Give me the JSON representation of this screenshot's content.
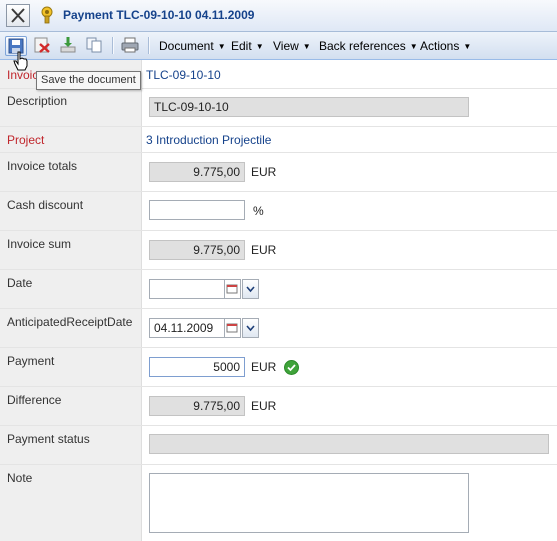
{
  "window": {
    "title": "Payment TLC-09-10-10 04.11.2009"
  },
  "toolbar": {
    "menus": [
      {
        "label": "Document"
      },
      {
        "label": "Edit"
      },
      {
        "label": "View"
      },
      {
        "label": "Back references"
      },
      {
        "label": "Actions"
      }
    ],
    "tooltip": "Save the document"
  },
  "form": {
    "invoice": {
      "label": "Invoice",
      "value": "TLC-09-10-10"
    },
    "description": {
      "label": "Description",
      "value": "TLC-09-10-10"
    },
    "project": {
      "label": "Project",
      "value": "3 Introduction Projectile"
    },
    "invoice_totals": {
      "label": "Invoice totals",
      "value": "9.775,00",
      "unit": "EUR"
    },
    "cash_discount": {
      "label": "Cash discount",
      "value": "",
      "unit": "%"
    },
    "invoice_sum": {
      "label": "Invoice sum",
      "value": "9.775,00",
      "unit": "EUR"
    },
    "date": {
      "label": "Date",
      "value": ""
    },
    "anticipated_receipt_date": {
      "label": "AnticipatedReceiptDate",
      "value": "04.11.2009"
    },
    "payment": {
      "label": "Payment",
      "value": "5000",
      "unit": "EUR"
    },
    "difference": {
      "label": "Difference",
      "value": "9.775,00",
      "unit": "EUR"
    },
    "payment_status": {
      "label": "Payment status",
      "value": ""
    },
    "note": {
      "label": "Note",
      "value": ""
    }
  },
  "colors": {
    "link": "#15428b",
    "required_label": "#c0262c",
    "valid_check": "#3fa33a"
  },
  "icons": [
    "close-icon",
    "document-payment-icon",
    "save-icon",
    "delete-icon",
    "import-icon",
    "copy-icon",
    "print-icon",
    "calendar-icon",
    "chevron-down-icon",
    "checkmark-icon",
    "hand-cursor-icon"
  ]
}
